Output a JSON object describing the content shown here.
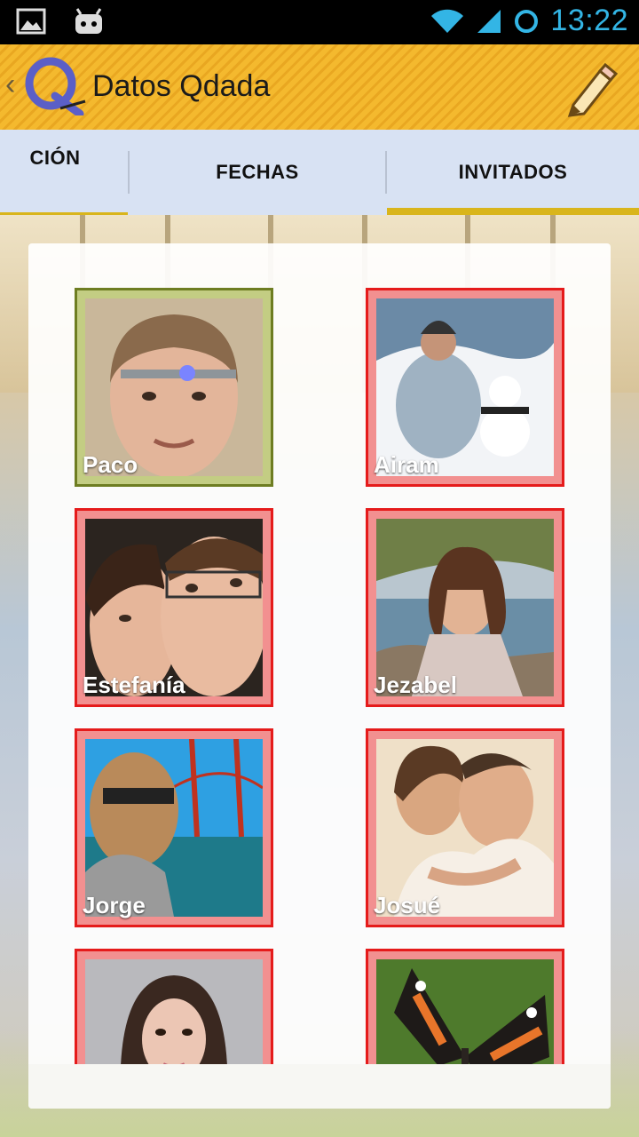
{
  "status_bar": {
    "time": "13:22",
    "icons": [
      "image-icon",
      "android-robot-icon",
      "wifi-icon",
      "cell-signal-icon",
      "circle-sync-icon"
    ]
  },
  "action_bar": {
    "title": "Datos Qdada",
    "logo_text": "Q",
    "action_icon": "pencil-edit-icon"
  },
  "tabs": [
    {
      "label": "CIÓN",
      "active": false
    },
    {
      "label": "FECHAS",
      "active": false
    },
    {
      "label": "INVITADOS",
      "active": true
    }
  ],
  "guests": [
    {
      "name": "Paco",
      "selected": true
    },
    {
      "name": "Airam",
      "selected": false
    },
    {
      "name": "Estefanía",
      "selected": false
    },
    {
      "name": "Jezabel",
      "selected": false
    },
    {
      "name": "Jorge",
      "selected": false
    },
    {
      "name": "Josué",
      "selected": false
    },
    {
      "name": "",
      "selected": false
    },
    {
      "name": "",
      "selected": false
    }
  ],
  "colors": {
    "accent": "#d9b51c",
    "status": "#33b5e5",
    "tile_red": "#e51b1b",
    "tile_selected": "#6e7d22",
    "tab_bg": "#d8e2f3"
  }
}
